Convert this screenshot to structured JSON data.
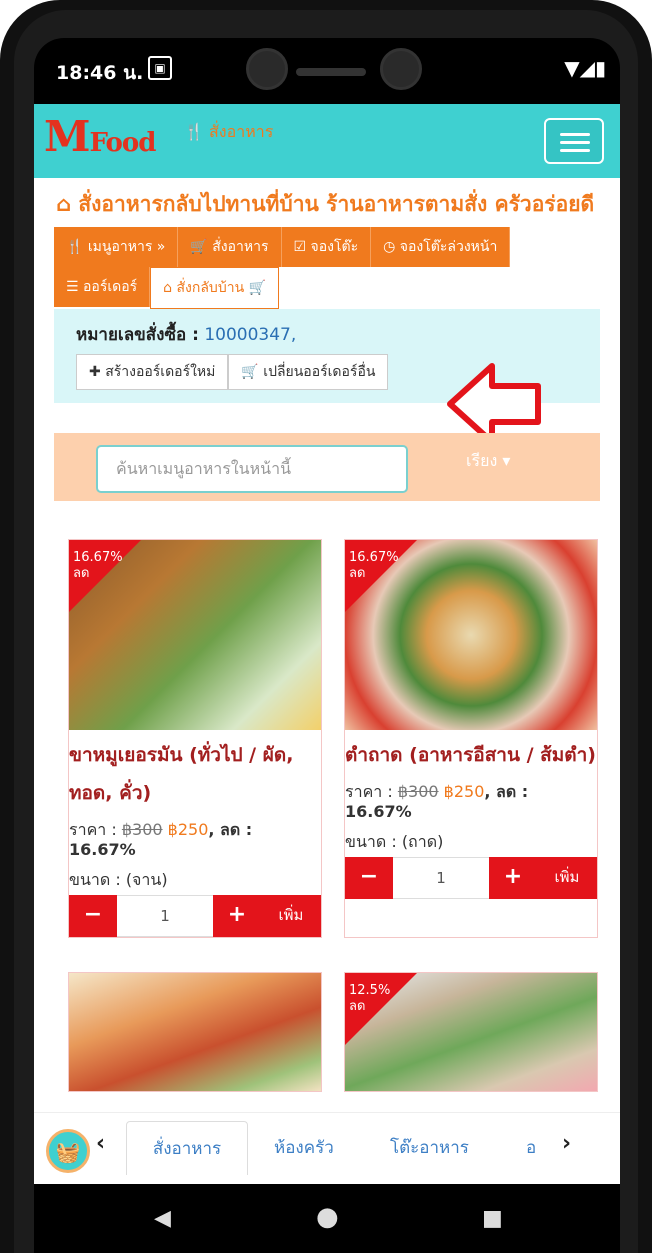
{
  "status": {
    "time": "18:46 น."
  },
  "brand": {
    "logo_m": "M",
    "logo_food": "Food",
    "nav_link": "สั่งอาหาร"
  },
  "page": {
    "title": "สั่งอาหารกลับไปทานที่บ้าน ร้านอาหารตามสั่ง ครัวอร่อยดี"
  },
  "tabs": [
    {
      "label": "เมนูอาหาร »",
      "icon": "utensils-icon"
    },
    {
      "label": "สั่งอาหาร",
      "icon": "cart-icon"
    },
    {
      "label": "จองโต๊ะ",
      "icon": "check-square-icon"
    },
    {
      "label": "จองโต๊ะล่วงหน้า",
      "icon": "clock-icon"
    },
    {
      "label": "ออร์เดอร์",
      "icon": "list-icon"
    },
    {
      "label": "สั่งกลับบ้าน",
      "icon": "home-icon"
    }
  ],
  "order": {
    "label": "หมายเลขสั่งซื้อ :",
    "number": "10000347,",
    "new_order": "สร้างออร์เดอร์ใหม่",
    "switch_order": "เปลี่ยนออร์เดอร์อื่น"
  },
  "search": {
    "placeholder": "ค้นหาเมนูอาหารในหน้านี้",
    "sort_label": "เรียง ▾"
  },
  "products": [
    {
      "discount": "16.67%",
      "discount_word": "ลด",
      "name": "ขาหมูเยอรมัน (ทั่วไป / ผัด, ทอด, คั่ว)",
      "price_label": "ราคา :",
      "old_price": "฿300",
      "new_price": "฿250",
      "discount_label": ", ลด :",
      "discount_value": "16.67%",
      "size": "ขนาด : (จาน)",
      "qty": "1",
      "add": "เพิ่ม"
    },
    {
      "discount": "16.67%",
      "discount_word": "ลด",
      "name": "ตำถาด (อาหารอีสาน / ส้มตำ)",
      "price_label": "ราคา :",
      "old_price": "฿300",
      "new_price": "฿250",
      "discount_label": ", ลด :",
      "discount_value": "16.67%",
      "size": "ขนาด : (ถาด)",
      "qty": "1",
      "add": "เพิ่ม"
    }
  ],
  "products_row2": [
    {
      "discount": ""
    },
    {
      "discount": "12.5%",
      "discount_word": "ลด"
    }
  ],
  "bottom_nav": {
    "items": [
      "สั่งอาหาร",
      "ห้องครัว",
      "โต๊ะอาหาร",
      "อ"
    ]
  }
}
